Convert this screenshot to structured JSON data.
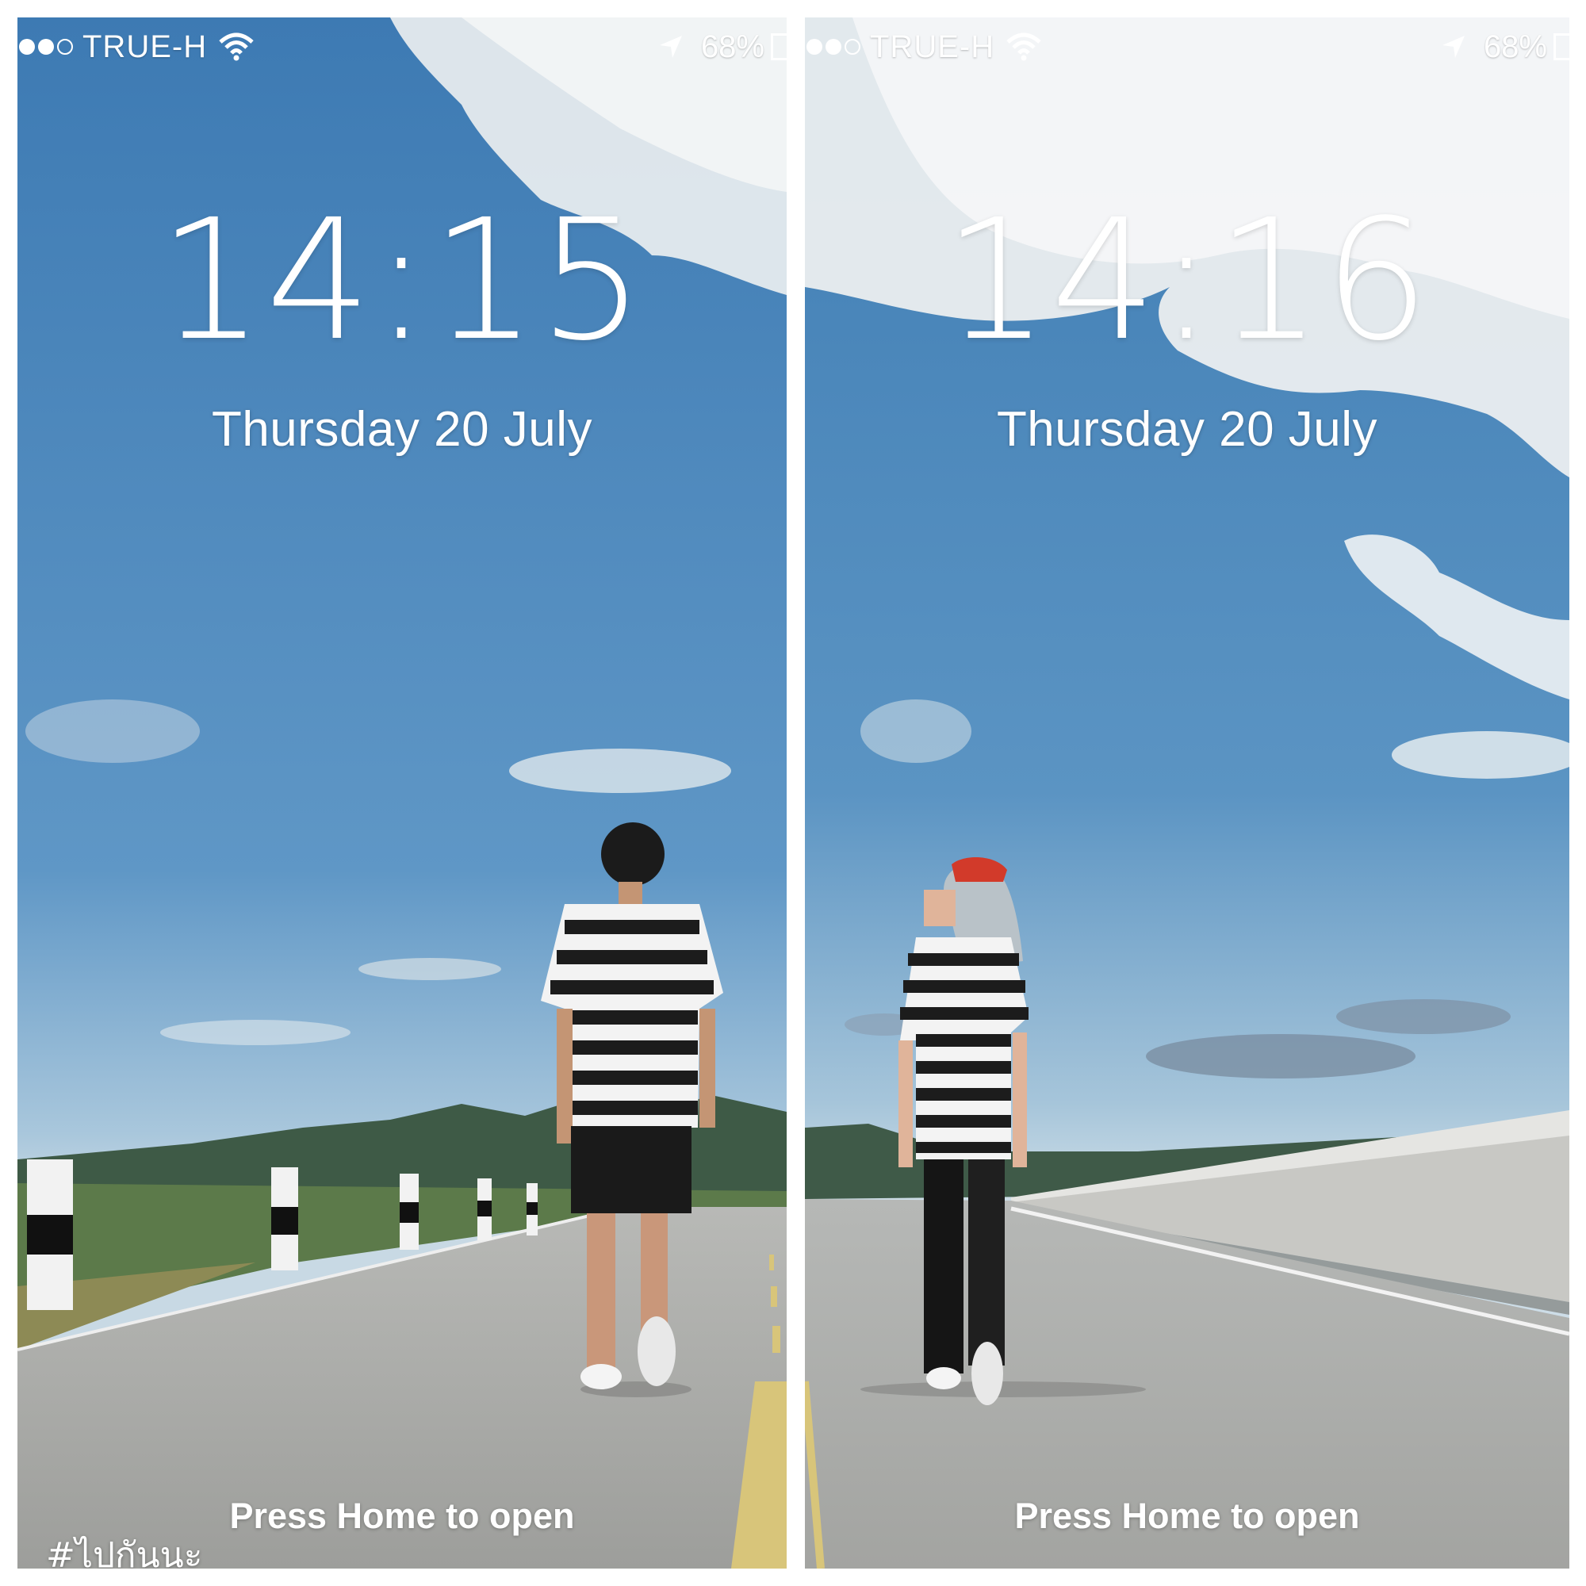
{
  "screens": [
    {
      "status": {
        "carrier": "TRUE-H",
        "battery": "68%"
      },
      "time": "14:15",
      "date": "Thursday 20 July",
      "hint": "Press Home to open"
    },
    {
      "status": {
        "carrier": "TRUE-H",
        "battery": "68%"
      },
      "time": "14:16",
      "date": "Thursday 20 July",
      "hint": "Press Home to open"
    }
  ],
  "hashtag": "#ไปกันนะ",
  "icons": [
    "signal-dots-icon",
    "wifi-icon",
    "location-arrow-icon",
    "battery-icon"
  ],
  "colors": {
    "sky_top": "#3f7db5",
    "sky_bottom": "#a8c8df",
    "road": "#a9aaa7",
    "text": "#ffffff"
  }
}
